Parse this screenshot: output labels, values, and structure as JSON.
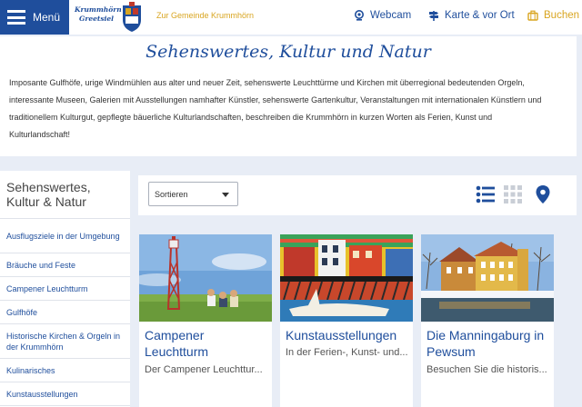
{
  "header": {
    "menu_label": "Menü",
    "logo_text_line1": "Krummhörn",
    "logo_text_line2": "Greetsiel",
    "home_link": "Zur Gemeinde Krummhörn",
    "nav": [
      {
        "label": "Webcam",
        "icon": "webcam-icon"
      },
      {
        "label": "Karte & vor Ort",
        "icon": "signpost-icon"
      },
      {
        "label": "Buchen",
        "icon": "suitcase-icon"
      }
    ]
  },
  "intro": {
    "title": "Sehenswertes, Kultur und Natur",
    "text": "Imposante Gulfhöfe, urige Windmühlen aus alter und neuer Zeit, sehenswerte Leuchttürme und  Kirchen mit überregional bedeutenden Orgeln, interessante Museen, Galerien mit Ausstellungen namhafter Künstler, sehenswerte Gartenkultur, Veranstaltungen mit internationalen Künstlern und traditionellem Kulturgut, gepflegte bäuerliche Kulturlandschaften, beschreiben die Krummhörn in kurzen Worten als Ferien, Kunst und Kulturlandschaft!"
  },
  "sidebar": {
    "title": "Sehenswertes, Kultur & Natur",
    "items": [
      {
        "label": "Ausflugsziele in der Umgebung"
      },
      {
        "label": "Bräuche und Feste"
      },
      {
        "label": "Campener Leuchtturm"
      },
      {
        "label": "Gulfhöfe"
      },
      {
        "label": "Historische Kirchen & Orgeln in der Krummhörn"
      },
      {
        "label": "Kulinarisches"
      },
      {
        "label": "Kunstausstellungen"
      }
    ]
  },
  "toolbar": {
    "sort_label": "Sortieren",
    "view_icons": [
      "list-view-icon",
      "grid-view-icon",
      "map-pin-icon"
    ]
  },
  "cards": [
    {
      "title": "Campener Leuchtturm",
      "teaser": "Der Campener Leuchttur..."
    },
    {
      "title": "Kunstausstellungen",
      "teaser": "In der Ferien-, Kunst- und..."
    },
    {
      "title": "Die Manningaburg in Pewsum",
      "teaser": "Besuchen Sie die historis..."
    }
  ],
  "colors": {
    "brand_blue": "#1f4e9c",
    "accent_gold": "#d9a520",
    "background": "#e8edf6"
  }
}
